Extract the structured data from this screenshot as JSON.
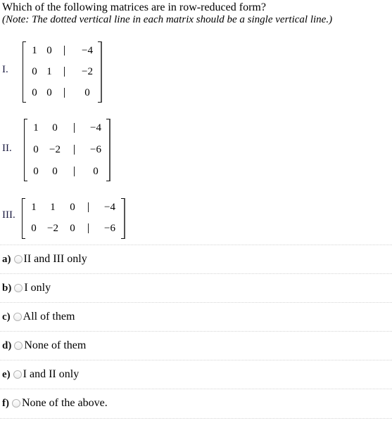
{
  "question": {
    "text": "Which of the following matrices are in row-reduced form?",
    "note": "(Note: The dotted vertical line in each matrix should be a single vertical line.)"
  },
  "matrices": [
    {
      "label": "I.",
      "rows": [
        {
          "coeffs": [
            "1",
            "0"
          ],
          "rhs": "−4"
        },
        {
          "coeffs": [
            "0",
            "1"
          ],
          "rhs": "−2"
        },
        {
          "coeffs": [
            "0",
            "0"
          ],
          "rhs": "0"
        }
      ]
    },
    {
      "label": "II.",
      "rows": [
        {
          "coeffs": [
            "1",
            "0"
          ],
          "rhs": "−4"
        },
        {
          "coeffs": [
            "0",
            "−2"
          ],
          "rhs": "−6"
        },
        {
          "coeffs": [
            "0",
            "0"
          ],
          "rhs": "0"
        }
      ]
    },
    {
      "label": "III.",
      "rows": [
        {
          "coeffs": [
            "1",
            "1",
            "0"
          ],
          "rhs": "−4"
        },
        {
          "coeffs": [
            "0",
            "−2",
            "0"
          ],
          "rhs": "−6"
        }
      ]
    }
  ],
  "options": [
    {
      "letter": "a)",
      "text": "II and III only",
      "selected": false
    },
    {
      "letter": "b)",
      "text": "I only",
      "selected": false
    },
    {
      "letter": "c)",
      "text": "All of them",
      "selected": false
    },
    {
      "letter": "d)",
      "text": "None of them",
      "selected": false
    },
    {
      "letter": "e)",
      "text": "I and II only",
      "selected": false
    },
    {
      "letter": "f)",
      "text": "None of the above.",
      "selected": false
    }
  ]
}
